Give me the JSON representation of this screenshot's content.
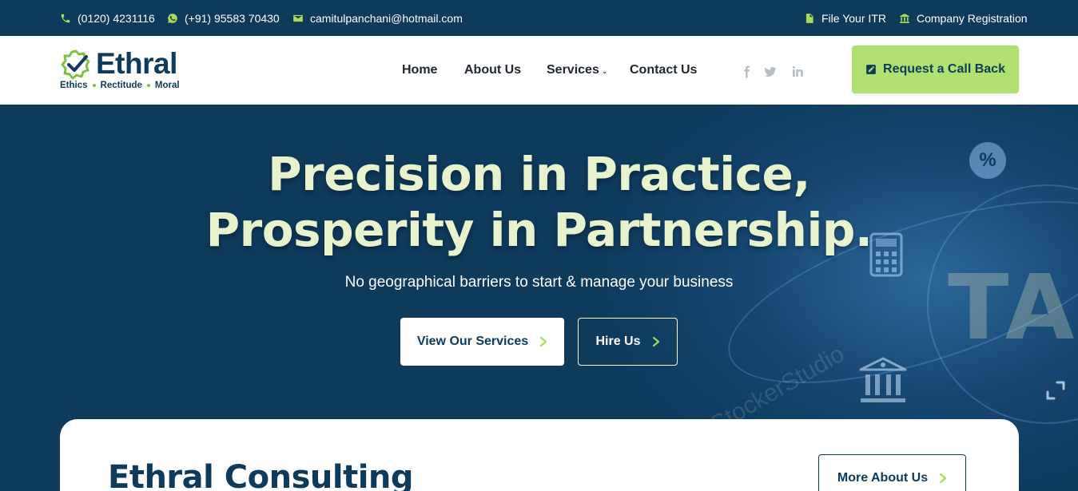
{
  "topbar": {
    "phone1": "(0120) 4231116",
    "phone2": "(+91) 95583 70430",
    "email": "camitulpanchani@hotmail.com",
    "link_itr": "File Your ITR",
    "link_company": "Company Registration"
  },
  "logo": {
    "name": "Ethral",
    "tag1": "Ethics",
    "tag2": "Rectitude",
    "tag3": "Moral"
  },
  "nav": {
    "items": [
      {
        "label": "Home"
      },
      {
        "label": "About Us"
      },
      {
        "label": "Services"
      },
      {
        "label": "Contact Us"
      }
    ]
  },
  "social": [
    "facebook-icon",
    "twitter-icon",
    "linkedin-icon"
  ],
  "cta": {
    "label": "Request a Call Back"
  },
  "hero": {
    "title_line1": "Precision in Practice,",
    "title_line2": "Prosperity in Partnership.",
    "subtitle": "No geographical barriers to start & manage your business",
    "btn_services": "View Our Services",
    "btn_hire": "Hire Us",
    "deco_tax": "TA",
    "watermark": "StockerStudio"
  },
  "card": {
    "title": "Ethral Consulting",
    "btn_more": "More About Us"
  },
  "colors": {
    "primary": "#0e3a5c",
    "accent": "#a6dc5a",
    "cta_bg": "#b0e070",
    "hero_title": "#e7f3cf"
  }
}
